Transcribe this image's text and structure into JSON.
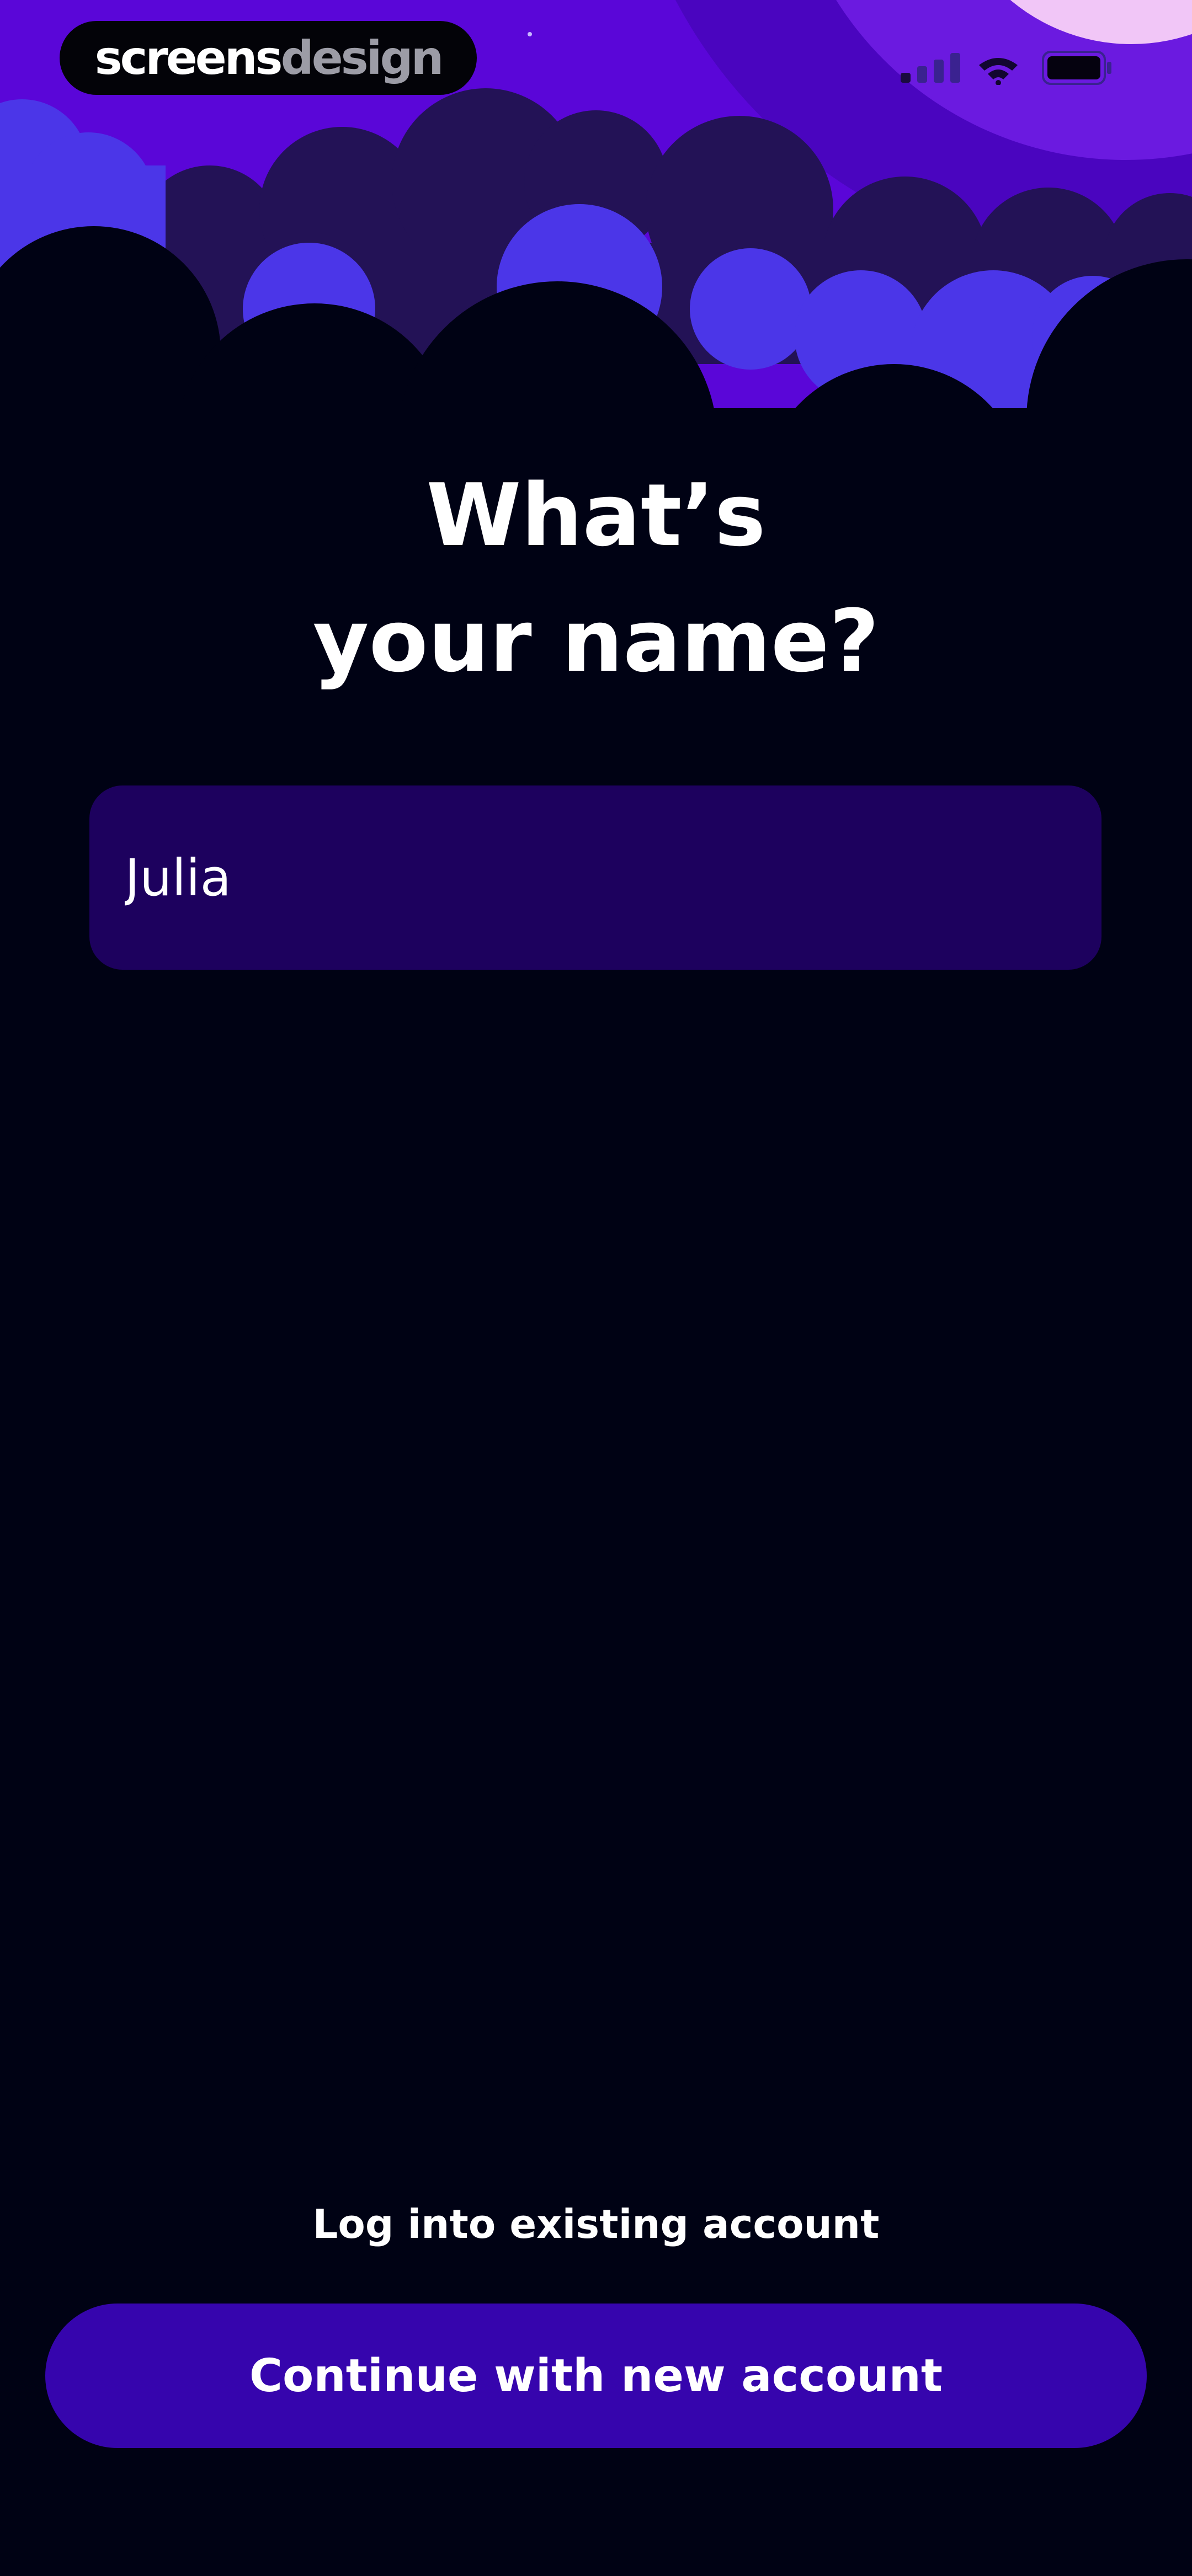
{
  "brand": {
    "part1": "screens",
    "part2": "design"
  },
  "status_bar": {
    "icons": [
      "cellular-signal-icon",
      "wifi-icon",
      "battery-icon"
    ]
  },
  "onboarding": {
    "title_line1": "What’s",
    "title_line2": "your name?",
    "name_value": "Julia",
    "login_link": "Log into existing account",
    "continue_button": "Continue with new account"
  },
  "colors": {
    "background": "#000214",
    "sky": "#5a06d8",
    "moon": "#f1c6f7",
    "clouds_light": "#4b36e8",
    "clouds_dark": "#231256",
    "field_bg": "#1d015e",
    "button_bg": "#3605ad",
    "text": "#ffffff"
  }
}
